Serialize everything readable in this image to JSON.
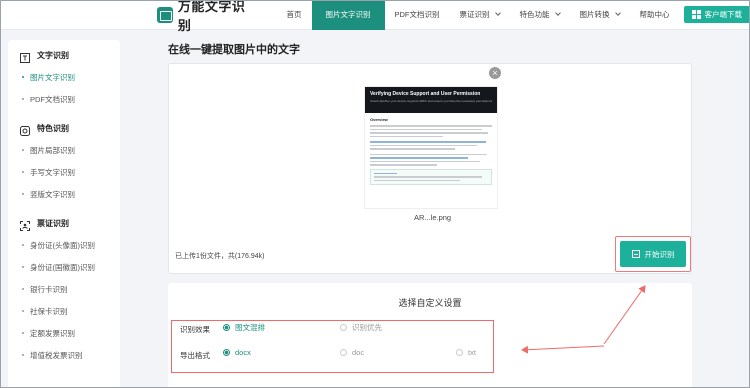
{
  "topbar": {
    "logo_text": "万能文字识别",
    "nav": [
      {
        "label": "首页",
        "active": false,
        "caret": false
      },
      {
        "label": "图片文字识别",
        "active": true,
        "caret": false
      },
      {
        "label": "PDF文档识别",
        "active": false,
        "caret": false
      },
      {
        "label": "票证识别",
        "active": false,
        "caret": true
      },
      {
        "label": "特色功能",
        "active": false,
        "caret": true
      },
      {
        "label": "图片转换",
        "active": false,
        "caret": true
      },
      {
        "label": "帮助中心",
        "active": false,
        "caret": false
      }
    ],
    "download_label": "客户端下载"
  },
  "sidebar": {
    "sections": [
      {
        "title": "文字识别",
        "icon": "text-recognition-icon",
        "items": [
          {
            "label": "图片文字识别",
            "active": true
          },
          {
            "label": "PDF文档识别",
            "active": false
          }
        ]
      },
      {
        "title": "特色识别",
        "icon": "feature-icon",
        "items": [
          {
            "label": "图片局部识别",
            "active": false
          },
          {
            "label": "手写文字识别",
            "active": false
          },
          {
            "label": "竖版文字识别",
            "active": false
          }
        ]
      },
      {
        "title": "票证识别",
        "icon": "id-card-icon",
        "items": [
          {
            "label": "身份证(头像面)识别",
            "active": false
          },
          {
            "label": "身份证(国徽面)识别",
            "active": false
          },
          {
            "label": "银行卡识别",
            "active": false
          },
          {
            "label": "社保卡识别",
            "active": false
          },
          {
            "label": "定额发票识别",
            "active": false
          },
          {
            "label": "增值税发票识别",
            "active": false
          }
        ]
      }
    ]
  },
  "main": {
    "page_title": "在线一键提取图片中的文字",
    "preview": {
      "heading": "Verifying Device Support and User Permission",
      "subheading": "Check whether your device supports ARKit and ensure you have the necessary permissions.",
      "section": "Overview"
    },
    "file_name": "AR...le.png",
    "upload_info": "已上传1份文件，共(176.94k)",
    "start_label": "开始识别",
    "settings": {
      "title": "选择自定义设置",
      "effect_label": "识别效果",
      "effect_options": [
        {
          "label": "图文混排",
          "selected": true
        },
        {
          "label": "识别优先",
          "selected": false
        }
      ],
      "format_label": "导出格式",
      "format_options": [
        {
          "label": "docx",
          "selected": true
        },
        {
          "label": "doc",
          "selected": false
        },
        {
          "label": "txt",
          "selected": false
        }
      ]
    }
  },
  "colors": {
    "brand": "#1d8f7e",
    "button": "#1db09a",
    "highlight": "#ef6b69"
  }
}
